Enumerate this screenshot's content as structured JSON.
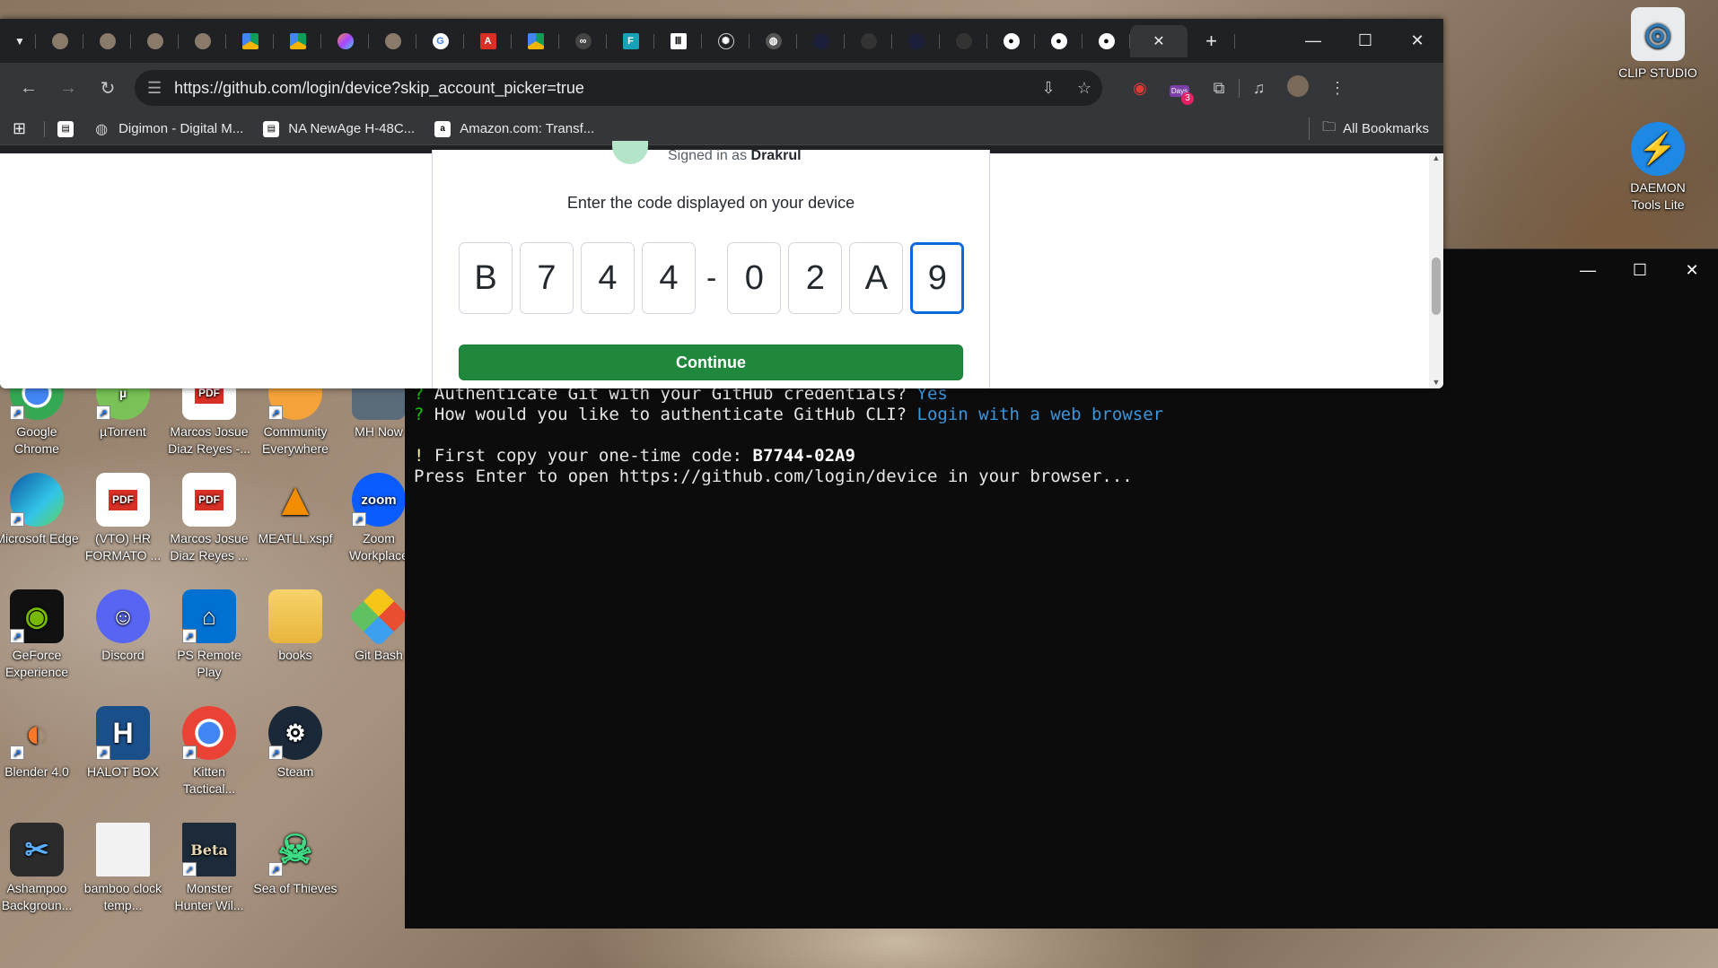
{
  "desktop": {
    "right_icons": [
      {
        "label": "CLIP STUDIO",
        "icon": "clip-studio-icon"
      },
      {
        "label": "DAEMON Tools Lite",
        "icon": "daemon-tools-icon"
      }
    ],
    "icons": [
      {
        "label": "Google Chrome",
        "icon": "chrome-icon"
      },
      {
        "label": "µTorrent",
        "icon": "utorrent-icon"
      },
      {
        "label": "Marcos Josue Diaz Reyes -...",
        "icon": "pdf-icon"
      },
      {
        "label": "Community Everywhere",
        "icon": "community-icon"
      },
      {
        "label": "MH Now",
        "icon": "mh-now-icon"
      },
      {
        "label": "Microsoft Edge",
        "icon": "edge-icon"
      },
      {
        "label": "(VTO) HR FORMATO ...",
        "icon": "pdf-icon"
      },
      {
        "label": "Marcos Josue Diaz Reyes ...",
        "icon": "pdf-icon"
      },
      {
        "label": "MEATLL.xspf",
        "icon": "vlc-icon"
      },
      {
        "label": "Zoom Workplace",
        "icon": "zoom-icon"
      },
      {
        "label": "GeForce Experience",
        "icon": "geforce-icon"
      },
      {
        "label": "Discord",
        "icon": "discord-icon"
      },
      {
        "label": "PS Remote Play",
        "icon": "ps-remote-icon"
      },
      {
        "label": "books",
        "icon": "folder-icon"
      },
      {
        "label": "Git Bash",
        "icon": "git-bash-icon"
      },
      {
        "label": "Blender 4.0",
        "icon": "blender-icon"
      },
      {
        "label": "HALOT BOX",
        "icon": "halot-box-icon"
      },
      {
        "label": "Kitten Tactical...",
        "icon": "chrome-icon"
      },
      {
        "label": "Steam",
        "icon": "steam-icon"
      },
      {
        "label": "Ashampoo Backgroun...",
        "icon": "ashampoo-icon"
      },
      {
        "label": "bamboo clock temp...",
        "icon": "document-icon"
      },
      {
        "label": "Monster Hunter Wil...",
        "icon": "monster-hunter-icon"
      },
      {
        "label": "Sea of Thieves",
        "icon": "sea-of-thieves-icon"
      }
    ],
    "zoom_text": "zoom",
    "pdf_text": "PDF",
    "beta_text": "Beta"
  },
  "terminal": {
    "line1_mark": "?",
    "line1_text": " Authenticate Git with your GitHub credentials? ",
    "line1_answer": "Yes",
    "line2_mark": "?",
    "line2_text": " How would you like to authenticate GitHub CLI? ",
    "line2_answer": "Login with a web browser",
    "line3_mark": "!",
    "line3_text": " First copy your one-time code: ",
    "line3_code": "B7744-02A9",
    "line4_text": "Press Enter to open https://github.com/login/device in your browser..."
  },
  "browser": {
    "url": "https://github.com/login/device?skip_account_picker=true",
    "extension_badge": "3",
    "extension_days_label": "Days",
    "bookmarks": [
      {
        "label": "Digimon - Digital M...",
        "icon": "globe-icon"
      },
      {
        "label": "NA NewAge H-48C...",
        "icon": "safari-icon"
      },
      {
        "label": "Amazon.com: Transf...",
        "icon": "amazon-icon"
      }
    ],
    "all_bookmarks": "All Bookmarks"
  },
  "page": {
    "signed_in_prefix": "Signed in as ",
    "signed_in_user": "Drakrul",
    "prompt": "Enter the code displayed on your device",
    "code_chars": [
      "B",
      "7",
      "4",
      "4",
      "0",
      "2",
      "A",
      "9"
    ],
    "dash": "-",
    "continue_label": "Continue"
  },
  "colors": {
    "accent": "#1f883d",
    "focus": "#0969da",
    "terminal_green": "#16c60c",
    "terminal_blue": "#3a96dd"
  }
}
